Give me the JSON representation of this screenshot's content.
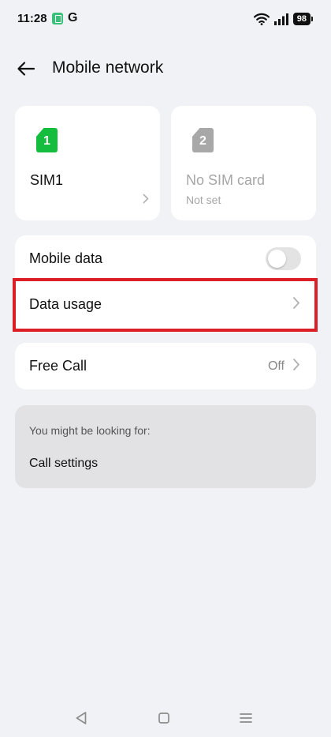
{
  "status_bar": {
    "time": "11:28",
    "carrier_glyph": "G",
    "battery": "98",
    "icons": [
      "app-notification-icon",
      "wifi-icon",
      "signal-icon",
      "battery-icon"
    ]
  },
  "header": {
    "title": "Mobile network",
    "back_icon": "arrow-left-icon"
  },
  "sims": [
    {
      "badge": "1",
      "name": "SIM1",
      "subtitle": "",
      "color": "#15bd3e",
      "active": true
    },
    {
      "badge": "2",
      "name": "No SIM card",
      "subtitle": "Not set",
      "color": "#a8a8a8",
      "active": false
    }
  ],
  "settings": {
    "mobile_data": {
      "label": "Mobile data",
      "enabled": false
    },
    "data_usage": {
      "label": "Data usage"
    },
    "free_call": {
      "label": "Free Call",
      "value": "Off"
    }
  },
  "suggestions": {
    "caption": "You might be looking for:",
    "items": [
      "Call settings"
    ]
  },
  "nav_bar": {
    "icons": [
      "nav-back-icon",
      "nav-home-icon",
      "nav-menu-icon"
    ]
  },
  "colors": {
    "background": "#f1f2f6",
    "card": "#ffffff",
    "sim_active": "#15bd3e",
    "sim_inactive": "#a8a8a8",
    "highlight": "#dc1f26",
    "suggestions_bg": "#e2e2e4"
  }
}
